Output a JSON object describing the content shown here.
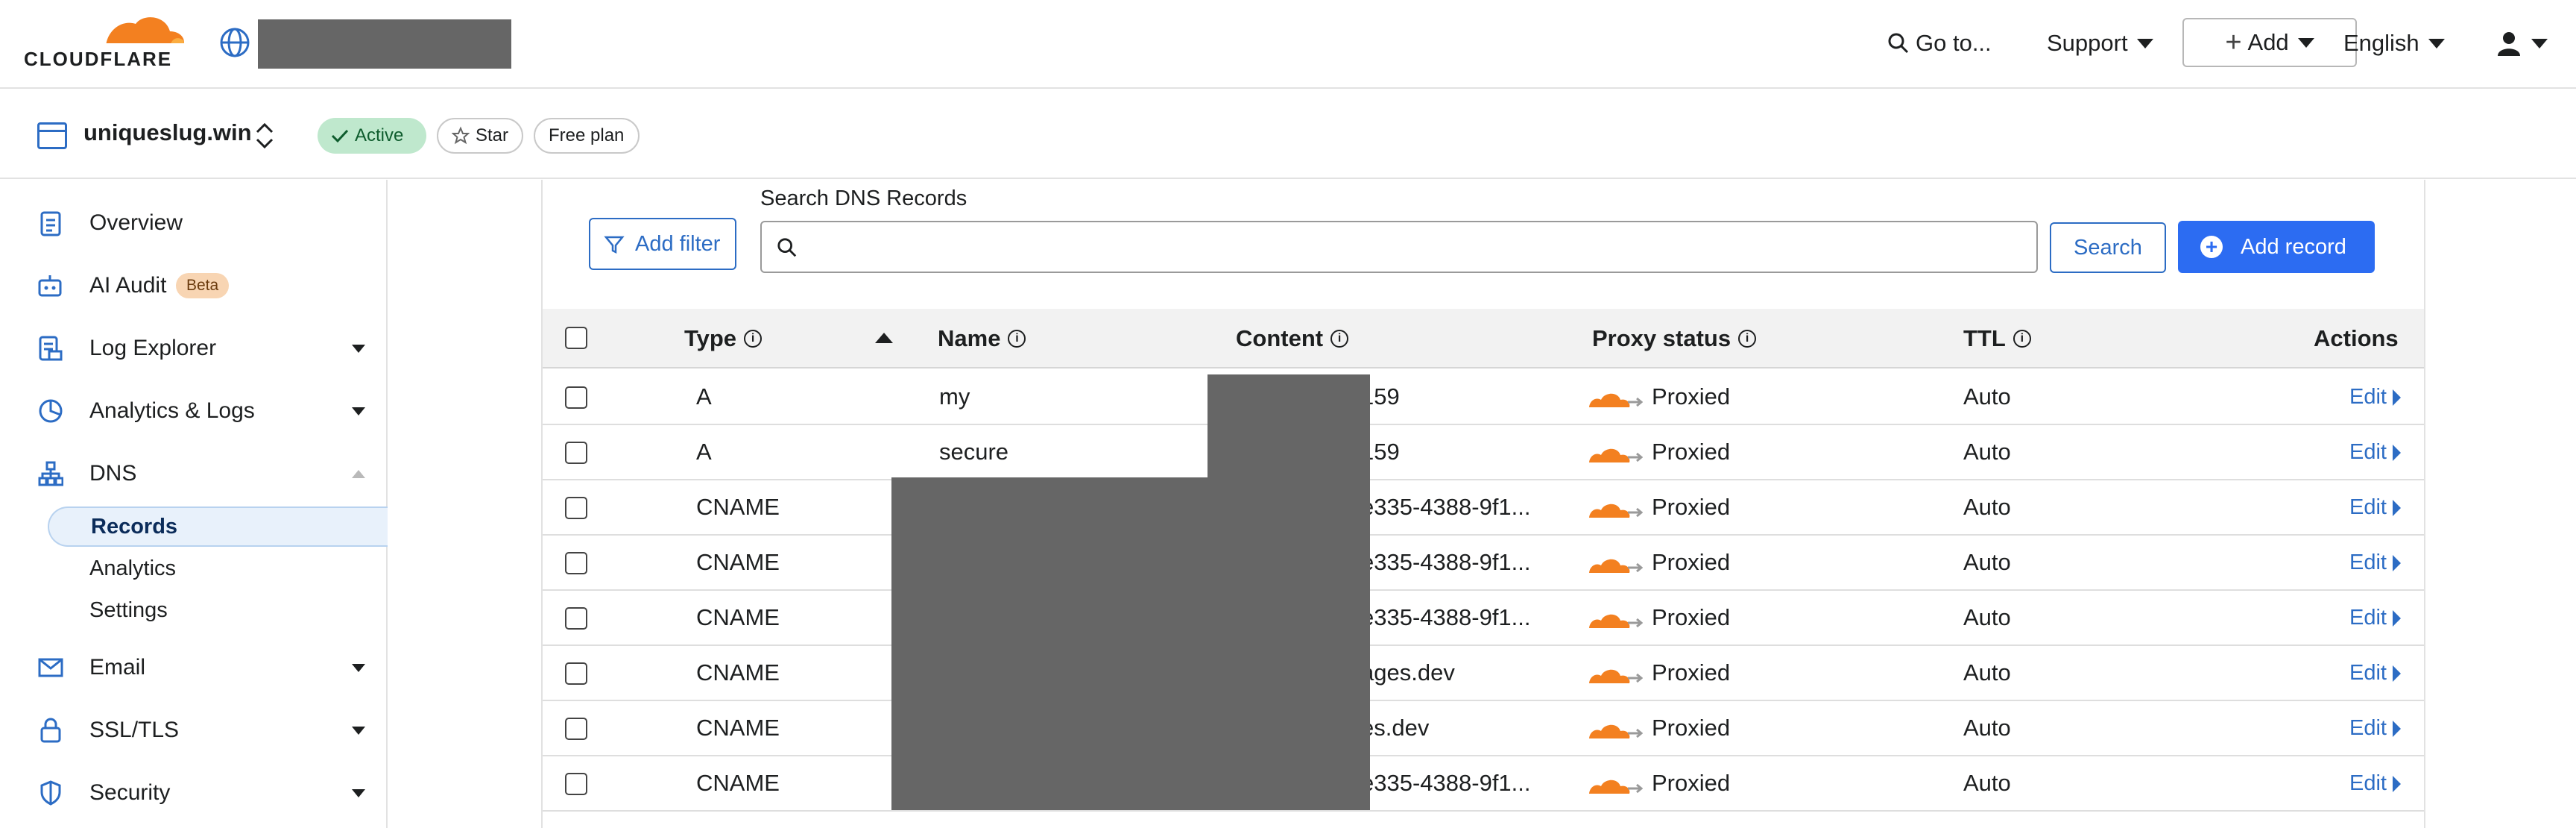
{
  "brand": {
    "name": "CLOUDFLARE",
    "accent": "#f38020",
    "link_color": "#2c6cc4"
  },
  "topbar": {
    "goto": "Go to...",
    "support": "Support",
    "add": "Add",
    "language": "English"
  },
  "zone": {
    "name": "uniqueslug.win",
    "status": "Active",
    "star": "Star",
    "plan": "Free plan"
  },
  "sidebar": {
    "items": [
      {
        "label": "Overview",
        "icon": "clipboard-icon"
      },
      {
        "label": "AI Audit",
        "icon": "robot-icon",
        "badge": "Beta"
      },
      {
        "label": "Log Explorer",
        "icon": "log-icon"
      },
      {
        "label": "Analytics & Logs",
        "icon": "pie-chart-icon"
      },
      {
        "label": "DNS",
        "icon": "network-icon"
      },
      {
        "label": "Email",
        "icon": "envelope-icon"
      },
      {
        "label": "SSL/TLS",
        "icon": "lock-icon"
      },
      {
        "label": "Security",
        "icon": "shield-icon"
      }
    ],
    "dns_sub": [
      "Records",
      "Analytics",
      "Settings"
    ]
  },
  "dns": {
    "add_filter": "Add filter",
    "search_label": "Search DNS Records",
    "search_value": "",
    "search_button": "Search",
    "add_record": "Add record",
    "columns": [
      "Type",
      "Name",
      "Content",
      "Proxy status",
      "TTL",
      "Actions"
    ],
    "rows": [
      {
        "type": "A",
        "name": "my",
        "content": "159",
        "proxy": "Proxied",
        "ttl": "Auto",
        "action": "Edit"
      },
      {
        "type": "A",
        "name": "secure",
        "content": "159",
        "proxy": "Proxied",
        "ttl": "Auto",
        "action": "Edit"
      },
      {
        "type": "CNAME",
        "name": "",
        "content": "e335-4388-9f1...",
        "proxy": "Proxied",
        "ttl": "Auto",
        "action": "Edit"
      },
      {
        "type": "CNAME",
        "name": "",
        "content": "e335-4388-9f1...",
        "proxy": "Proxied",
        "ttl": "Auto",
        "action": "Edit"
      },
      {
        "type": "CNAME",
        "name": "",
        "content": "e335-4388-9f1...",
        "proxy": "Proxied",
        "ttl": "Auto",
        "action": "Edit"
      },
      {
        "type": "CNAME",
        "name": "",
        "content": "ages.dev",
        "proxy": "Proxied",
        "ttl": "Auto",
        "action": "Edit"
      },
      {
        "type": "CNAME",
        "name": "",
        "content": "es.dev",
        "proxy": "Proxied",
        "ttl": "Auto",
        "action": "Edit"
      },
      {
        "type": "CNAME",
        "name": "",
        "content": "e335-4388-9f1...",
        "proxy": "Proxied",
        "ttl": "Auto",
        "action": "Edit"
      }
    ]
  }
}
